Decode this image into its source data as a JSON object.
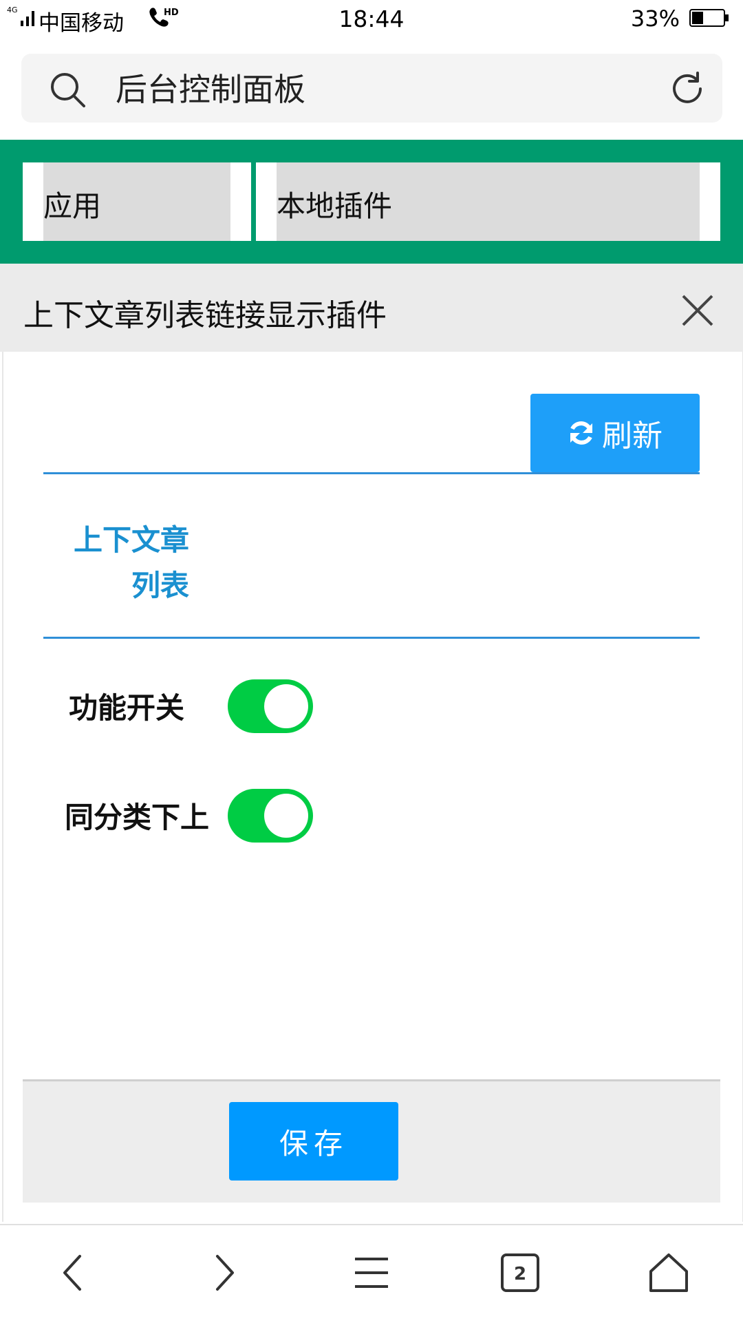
{
  "status_bar": {
    "carrier": "中国移动",
    "network": "4G",
    "time": "18:44",
    "battery_percent": "33%"
  },
  "search": {
    "text": "后台控制面板"
  },
  "tabs": [
    {
      "label": "应用"
    },
    {
      "label": "本地插件"
    }
  ],
  "panel": {
    "title": "上下文章列表链接显示插件",
    "refresh_label": "刷新",
    "section_title_line1": "上下文章",
    "section_title_line2": "列表",
    "toggles": [
      {
        "label": "功能开关",
        "on": true
      },
      {
        "label": "同分类下上",
        "on": true
      }
    ],
    "save_label": "保存"
  },
  "bottom_nav": {
    "tab_count": "2"
  },
  "colors": {
    "green_band": "#009b6e",
    "accent_blue": "#1e9ff9",
    "toggle_on": "#00cc44",
    "section_title": "#1a90d0"
  }
}
